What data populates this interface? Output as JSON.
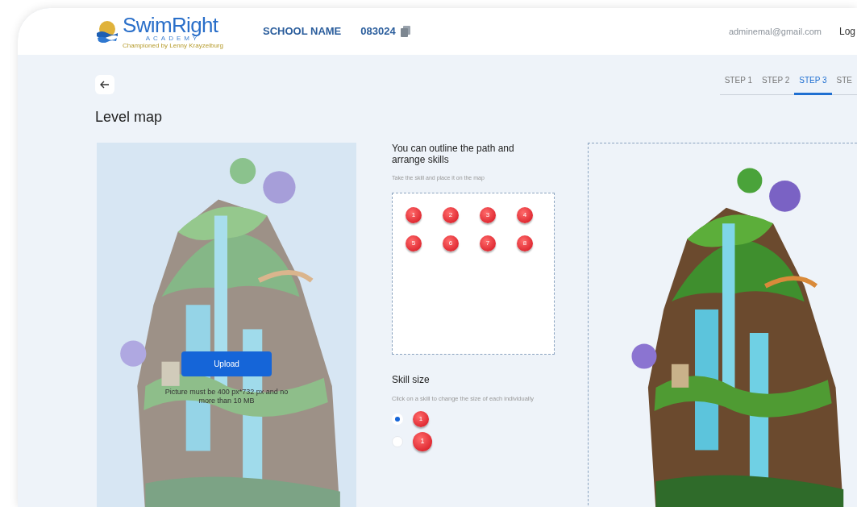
{
  "header": {
    "logo": {
      "name": "SwimRight",
      "subtitle": "ACADEMY",
      "tagline": "Championed by Lenny Krayzelburg"
    },
    "school_name": "SCHOOL NAME",
    "school_code": "083024",
    "email": "adminemal@gmail.com",
    "logout": "Log"
  },
  "steps": [
    {
      "label": "STEP 1",
      "selected": false
    },
    {
      "label": "STEP 2",
      "selected": false
    },
    {
      "label": "STEP 3",
      "selected": true
    },
    {
      "label": "STE",
      "selected": false
    }
  ],
  "title": "Level map",
  "upload": {
    "button": "Upload",
    "hint": "Picture must be 400 px*732 px and no more than 10 MB"
  },
  "skills_panel": {
    "heading": "You can outline the path and arrange skills",
    "hint": "Take the skill and place it on the map",
    "skills": [
      "1",
      "2",
      "3",
      "4",
      "5",
      "6",
      "7",
      "8"
    ]
  },
  "skill_size": {
    "heading": "Skill size",
    "hint": "Click on a skill to change the size of each individually",
    "options": [
      {
        "label": "1",
        "selected": true,
        "kind": "small"
      },
      {
        "label": "1",
        "selected": false,
        "kind": "large"
      }
    ]
  }
}
